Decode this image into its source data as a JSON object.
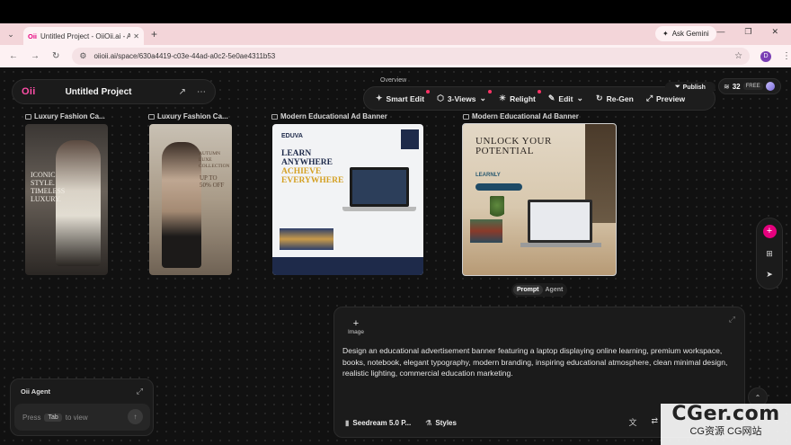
{
  "browser": {
    "tab_title": "Untitled Project - OiiOii.ai - AI A",
    "tab_favicon": "Oii",
    "new_tab": "+",
    "gemini_label": "Ask Gemini",
    "url": "oiioii.ai/space/630a4419-c03e-44ad-a0c2-5e0ae4311b53",
    "profile_initial": "D"
  },
  "app": {
    "logo_main": "Oii",
    "project_title": "Untitled Project",
    "overview_label": "Overview",
    "toolbar": [
      {
        "label": "Smart Edit",
        "icon": "sparkle-icon",
        "dot": true
      },
      {
        "label": "3-Views",
        "icon": "cube-icon",
        "dot": true
      },
      {
        "label": "Relight",
        "icon": "bulb-icon",
        "dot": true
      },
      {
        "label": "Edit",
        "icon": "pen-icon",
        "dot": false
      },
      {
        "label": "Re-Gen",
        "icon": "refresh-icon",
        "dot": false
      },
      {
        "label": "Preview",
        "icon": "expand-icon",
        "dot": false
      }
    ],
    "publish_label": "Publish",
    "credits": {
      "count": "32",
      "tier": "FREE"
    },
    "cards": [
      {
        "label": "Luxury Fashion Ca...",
        "text": "ICONIC STYLE. TIMELESS LUXURY."
      },
      {
        "label": "Luxury Fashion Ca...",
        "text": "AUTUMN LUXE COLLECTION",
        "sub": "UP TO 50% OFF"
      },
      {
        "label": "Modern Educational Ad Banner",
        "brand": "EDUVA",
        "h1": "LEARN ANYWHERE",
        "h2": "ACHIEVE EVERYWHERE"
      },
      {
        "label": "Modern Educational Ad Banner",
        "h1": "UNLOCK YOUR POTENTIAL",
        "brand": "LEARNLY"
      }
    ],
    "mode_toggle": {
      "active": "Prompt",
      "inactive": "Agent"
    },
    "prompt_panel": {
      "add_image_label": "Image",
      "text": "Design an educational advertisement banner featuring a laptop displaying online learning, premium workspace, books, notebook, elegant typography, modern branding, inspiring educational atmosphere, clean minimal design, realistic lighting, commercial education marketing.",
      "model_label": "Seedream 5.0 P...",
      "styles_label": "Styles"
    },
    "agent_panel": {
      "title": "Oii Agent",
      "press": "Press",
      "key": "Tab",
      "to_view": "to view"
    },
    "watermark": {
      "main": "CGer.com",
      "sub": "CG资源 CG网站"
    },
    "colors": {
      "accent": "#e6007e",
      "background": "#111111",
      "tabbar": "#f3d5d9"
    }
  }
}
